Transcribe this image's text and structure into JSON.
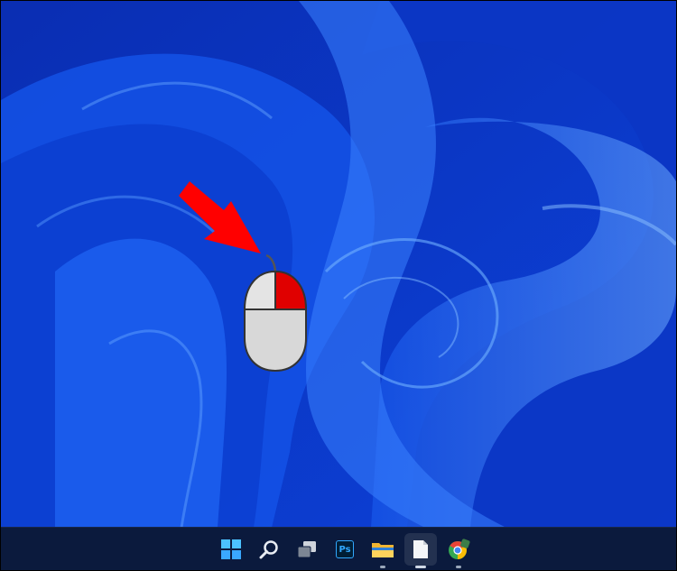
{
  "desktop": {
    "wallpaper": "windows-11-bloom",
    "colors": {
      "wallpaper_base": "#0a2fb8",
      "wallpaper_light": "#4a8dff",
      "taskbar": "#0b1a3d",
      "annotation_arrow": "#ff0000",
      "mouse_highlight": "#e00000"
    }
  },
  "annotation": {
    "arrow": "red-arrow-icon",
    "mouse": "mouse-right-click-icon",
    "highlighted_button": "right"
  },
  "taskbar": {
    "items": [
      {
        "name": "start",
        "icon": "windows-start-icon"
      },
      {
        "name": "search",
        "icon": "search-icon"
      },
      {
        "name": "task-view",
        "icon": "task-view-icon"
      },
      {
        "name": "photoshop",
        "icon": "photoshop-icon",
        "label": "Ps"
      },
      {
        "name": "file-explorer",
        "icon": "folder-icon"
      },
      {
        "name": "notepad",
        "icon": "document-icon",
        "active": true
      },
      {
        "name": "chrome",
        "icon": "chrome-icon"
      }
    ]
  }
}
